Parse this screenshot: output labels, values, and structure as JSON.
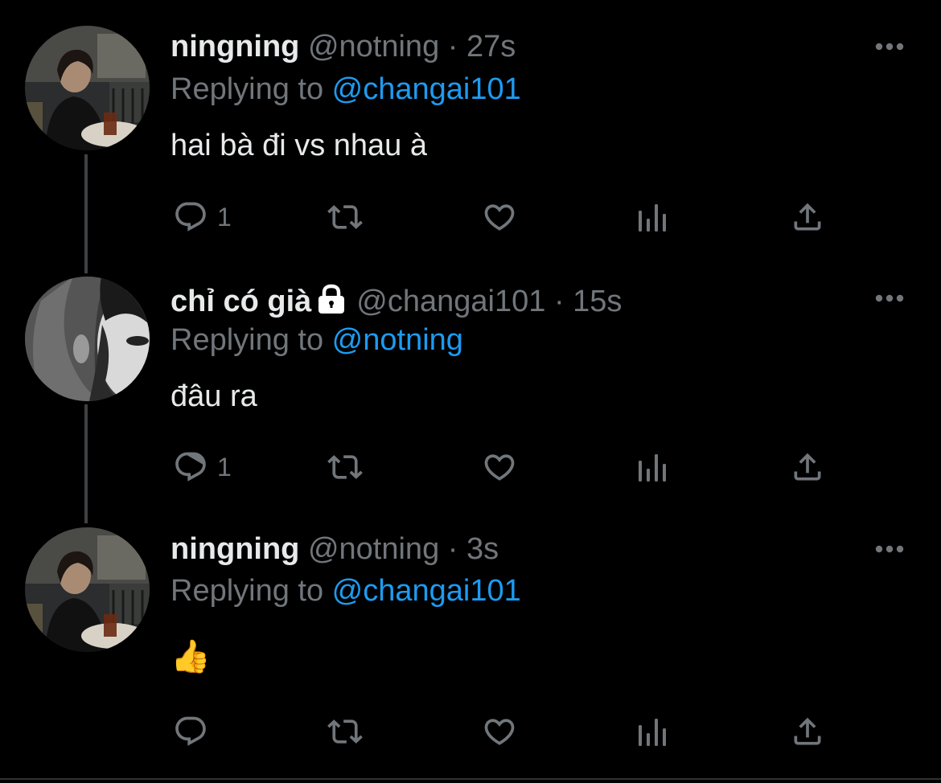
{
  "thread": {
    "tweets": [
      {
        "display_name": "ningning",
        "handle": "@notning",
        "separator": "·",
        "time": "27s",
        "replying_prefix": "Replying to ",
        "replying_to": "@changai101",
        "text": "hai bà đi vs nhau à",
        "reply_count": "1",
        "locked": false
      },
      {
        "display_name": "chỉ có già",
        "handle": "@changai101",
        "separator": "·",
        "time": "15s",
        "replying_prefix": "Replying to ",
        "replying_to": "@notning",
        "text": "đâu ra",
        "reply_count": "1",
        "locked": true
      },
      {
        "display_name": "ningning",
        "handle": "@notning",
        "separator": "·",
        "time": "3s",
        "replying_prefix": "Replying to ",
        "replying_to": "@changai101",
        "text": "👍",
        "reply_count": "",
        "locked": false
      }
    ]
  },
  "colors": {
    "background": "#000000",
    "primary_text": "#e7e9ea",
    "secondary_text": "#71767b",
    "accent": "#1d9bf0",
    "thread_line": "#3e4144"
  },
  "icons": [
    "more-icon",
    "reply-icon",
    "retweet-icon",
    "like-icon",
    "views-icon",
    "share-icon",
    "lock-icon"
  ]
}
